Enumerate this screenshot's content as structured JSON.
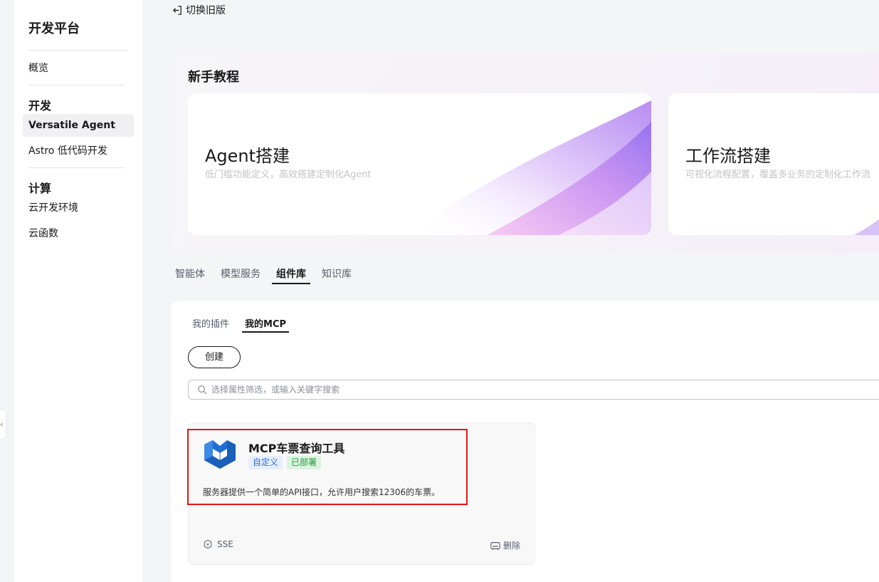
{
  "sidebar": {
    "brand": "开发平台",
    "overview": "概览",
    "section_dev": "开发",
    "versatile_agent": "Versatile Agent",
    "astro": "Astro 低代码开发",
    "section_compute": "计算",
    "cloud_env": "云开发环境",
    "cloud_func": "云函数"
  },
  "topbar": {
    "switch_old": "切换旧版"
  },
  "tutorial": {
    "title": "新手教程",
    "cards": [
      {
        "name": "Agent搭建",
        "desc": "低门槛功能定义，高效搭建定制化Agent"
      },
      {
        "name": "工作流搭建",
        "desc": "可视化流程配置，覆盖多业务的定制化工作流"
      }
    ]
  },
  "main_tabs": [
    "智能体",
    "模型服务",
    "组件库",
    "知识库"
  ],
  "sub_tabs": [
    "我的插件",
    "我的MCP"
  ],
  "actions": {
    "create": "创建"
  },
  "search": {
    "placeholder": "选择属性筛选，或输入关键字搜索"
  },
  "mcp_card": {
    "name": "MCP车票查询工具",
    "badge_custom": "自定义",
    "badge_deployed": "已部署",
    "desc": "服务器提供一个简单的API接口，允许用户搜索12306的车票。",
    "protocol": "SSE",
    "delete": "删除"
  },
  "colors": {
    "accent": "#191919",
    "highlight": "#e61414",
    "badge_custom": "#2e6fdb",
    "badge_deployed": "#1f9d3a",
    "logo_blue": "#1f6fd1"
  }
}
